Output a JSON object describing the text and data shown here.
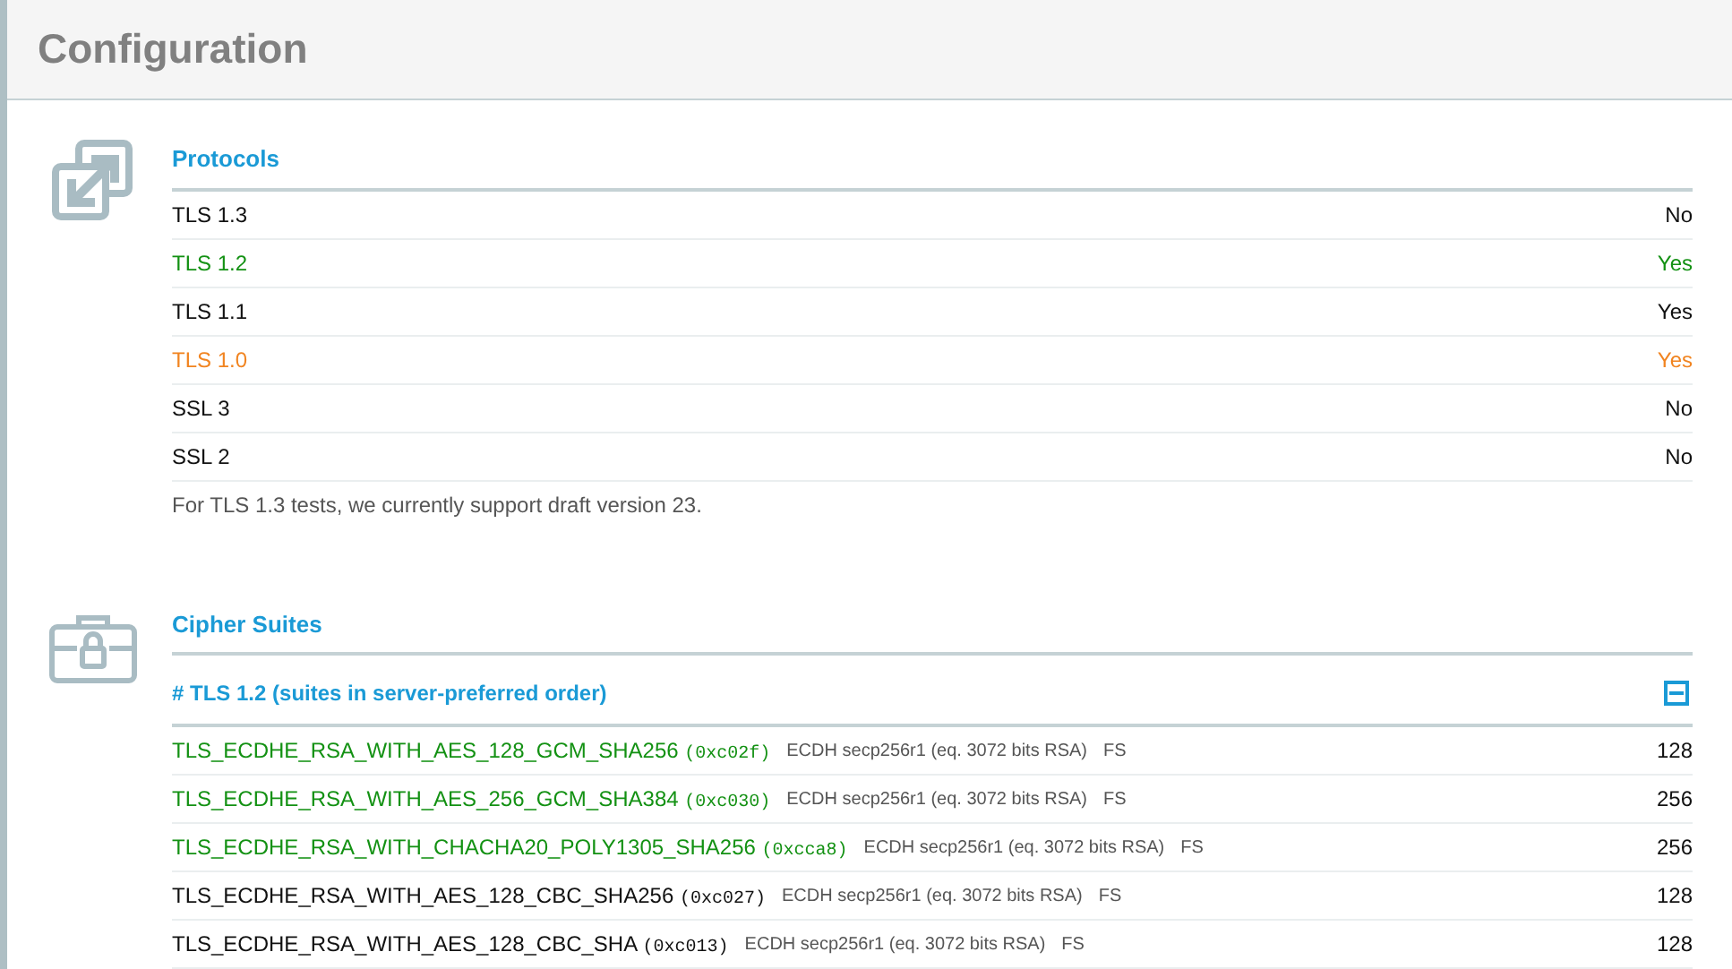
{
  "header": {
    "title": "Configuration"
  },
  "protocols": {
    "title": "Protocols",
    "rows": [
      {
        "name": "TLS 1.3",
        "value": "No",
        "color": "#111111"
      },
      {
        "name": "TLS 1.2",
        "value": "Yes",
        "color": "#139113"
      },
      {
        "name": "TLS 1.1",
        "value": "Yes",
        "color": "#111111"
      },
      {
        "name": "TLS 1.0",
        "value": "Yes",
        "color": "#f18420"
      },
      {
        "name": "SSL 3",
        "value": "No",
        "color": "#111111"
      },
      {
        "name": "SSL 2",
        "value": "No",
        "color": "#111111"
      }
    ],
    "note": "For TLS 1.3 tests, we currently support draft version 23."
  },
  "cipher_suites": {
    "title": "Cipher Suites",
    "group": {
      "title": "# TLS 1.2 (suites in server-preferred order)",
      "expanded": true,
      "rows": [
        {
          "name": "TLS_ECDHE_RSA_WITH_AES_128_GCM_SHA256",
          "code": "(0xc02f)",
          "key_exchange": "ECDH secp256r1 (eq. 3072 bits RSA)",
          "fs": "FS",
          "bits": "128",
          "color": "#139113"
        },
        {
          "name": "TLS_ECDHE_RSA_WITH_AES_256_GCM_SHA384",
          "code": "(0xc030)",
          "key_exchange": "ECDH secp256r1 (eq. 3072 bits RSA)",
          "fs": "FS",
          "bits": "256",
          "color": "#139113"
        },
        {
          "name": "TLS_ECDHE_RSA_WITH_CHACHA20_POLY1305_SHA256",
          "code": "(0xcca8)",
          "key_exchange": "ECDH secp256r1 (eq. 3072 bits RSA)",
          "fs": "FS",
          "bits": "256",
          "color": "#139113"
        },
        {
          "name": "TLS_ECDHE_RSA_WITH_AES_128_CBC_SHA256",
          "code": "(0xc027)",
          "key_exchange": "ECDH secp256r1 (eq. 3072 bits RSA)",
          "fs": "FS",
          "bits": "128",
          "color": "#111111"
        },
        {
          "name": "TLS_ECDHE_RSA_WITH_AES_128_CBC_SHA",
          "code": "(0xc013)",
          "key_exchange": "ECDH secp256r1 (eq. 3072 bits RSA)",
          "fs": "FS",
          "bits": "128",
          "color": "#111111"
        }
      ]
    }
  }
}
